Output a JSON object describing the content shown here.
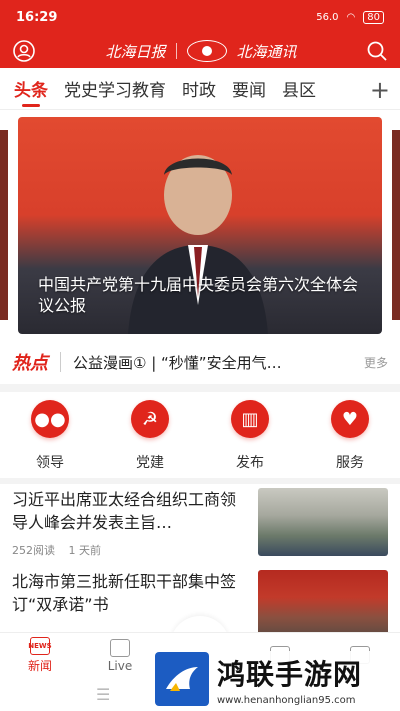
{
  "status_bar": {
    "time": "16:29",
    "network": "56.0",
    "network_unit": "KB/s",
    "battery": "80"
  },
  "header": {
    "paper_name": "北海日报",
    "app_name": "北海通讯"
  },
  "tabs": [
    "头条",
    "党史学习教育",
    "时政",
    "要闻",
    "县区"
  ],
  "hero": {
    "caption": "中国共产党第十九届中央委员会第六次全体会议公报"
  },
  "hot": {
    "label": "热点",
    "text": "公益漫画① | “秒懂”安全用气…",
    "more": "更多"
  },
  "services": [
    {
      "label": "领导",
      "icon": "people-icon"
    },
    {
      "label": "党建",
      "icon": "party-emblem-icon"
    },
    {
      "label": "发布",
      "icon": "building-icon"
    },
    {
      "label": "服务",
      "icon": "heart-hand-icon"
    }
  ],
  "news": [
    {
      "title": "习近平出席亚太经合组织工商领导人峰会并发表主旨…",
      "reads": "252阅读",
      "time": "1 天前"
    },
    {
      "title": "北海市第三批新任职干部集中签订“双承诺”书",
      "reads": "",
      "time": ""
    }
  ],
  "tabbar": [
    {
      "label": "新闻",
      "badge": "NEWS"
    },
    {
      "label": "Live"
    },
    {
      "label": ""
    },
    {
      "label": ""
    }
  ],
  "watermark": {
    "title": "鸿联手游网",
    "url": "www.henanhonglian95.com"
  },
  "colors": {
    "accent": "#e0251c"
  }
}
